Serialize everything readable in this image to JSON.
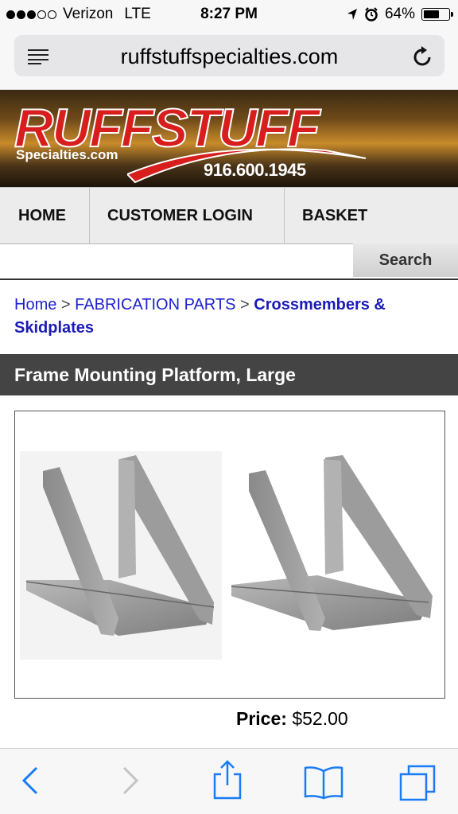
{
  "status_bar": {
    "carrier": "Verizon",
    "network": "LTE",
    "time": "8:27 PM",
    "battery": "64%",
    "battery_level": 0.64
  },
  "browser": {
    "url": "ruffstuffspecialties.com"
  },
  "banner": {
    "logo_text": "RUFFSTUFF",
    "logo_subtext": "Specialties.com",
    "phone": "916.600.1945"
  },
  "nav": {
    "home": "HOME",
    "login": "CUSTOMER LOGIN",
    "basket": "BASKET"
  },
  "search": {
    "button_label": "Search"
  },
  "breadcrumb": {
    "home": "Home",
    "sep1": ">",
    "category": "FABRICATION PARTS",
    "sep2": ">",
    "current": "Crossmembers & Skidplates"
  },
  "product": {
    "title": "Frame Mounting Platform, Large",
    "price_label": "Price:",
    "price_value": "$52.00"
  },
  "colors": {
    "accent_link": "#1e22cc",
    "title_bar": "#444444",
    "brand_red": "#d81d1d"
  }
}
